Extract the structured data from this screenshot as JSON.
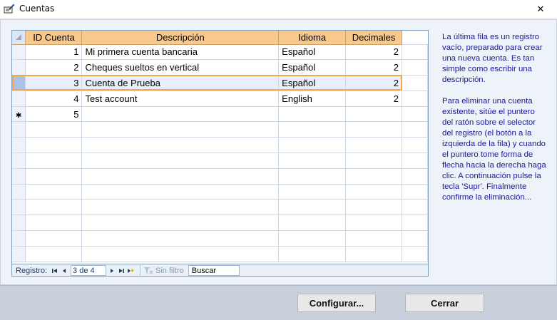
{
  "window": {
    "title": "Cuentas",
    "close_glyph": "✕"
  },
  "table": {
    "columns": [
      "ID Cuenta",
      "Descripción",
      "Idioma",
      "Decimales"
    ],
    "rows": [
      {
        "id": "1",
        "descripcion": "Mi primera cuenta bancaria",
        "idioma": "Español",
        "decimales": "2"
      },
      {
        "id": "2",
        "descripcion": "Cheques sueltos en vertical",
        "idioma": "Español",
        "decimales": "2"
      },
      {
        "id": "3",
        "descripcion": "Cuenta de Prueba",
        "idioma": "Español",
        "decimales": "2"
      },
      {
        "id": "4",
        "descripcion": "Test account",
        "idioma": "English",
        "decimales": "2"
      }
    ],
    "new_row": {
      "marker": "✱",
      "id": "5"
    },
    "current_row_index": 2
  },
  "navigation": {
    "label": "Registro:",
    "record_position": "3 de 4",
    "filter_label": "Sin filtro",
    "search_label": "Buscar"
  },
  "help": {
    "paragraph1": "La última fila es un registro vacío, preparado para crear una nueva cuenta. Es tan simple como escribir una descripción.",
    "paragraph2": "Para eliminar una cuenta existente, sitúe el puntero del ratón sobre el selector del registro (el botón a la izquierda de la fila) y cuando el puntero tome forma de flecha hacia la derecha haga clic. A continuación pulse la tecla 'Supr'. Finalmente confirme la eliminación..."
  },
  "buttons": {
    "configure": "Configurar...",
    "close": "Cerrar"
  },
  "colors": {
    "header": "#f9c98c",
    "current_row_outline": "#f5a64a",
    "help_text": "#1a1a9c",
    "footer": "#c8d0dc"
  }
}
